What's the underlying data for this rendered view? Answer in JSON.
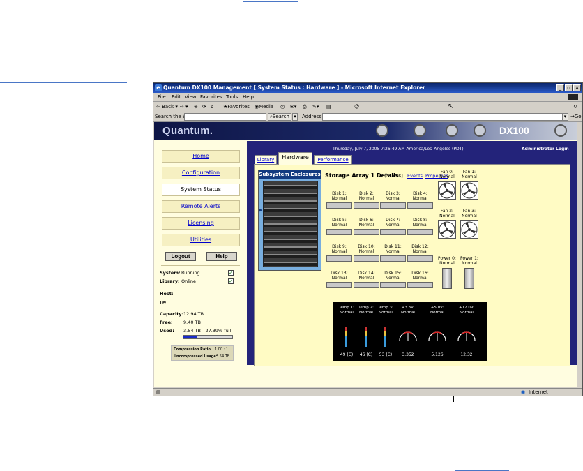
{
  "window": {
    "title": "Quantum DX100 Management [ System Status : Hardware ] - Microsoft Internet Explorer"
  },
  "menu": [
    "File",
    "Edit",
    "View",
    "Favorites",
    "Tools",
    "Help"
  ],
  "toolbar": {
    "back": "Back",
    "favorites": "Favorites",
    "media": "Media"
  },
  "searchbar": {
    "label": "Search the Web",
    "search_btn": "Search",
    "address_label": "Address",
    "go": "Go"
  },
  "banner": {
    "logo": "Quantum.",
    "model": "DX100"
  },
  "header": {
    "datetime": "Thursday, July 7, 2005 7:26:49 AM America/Los_Angeles (PDT)",
    "login": "Administrator Login"
  },
  "nav": [
    "Home",
    "Configuration",
    "System Status",
    "Remote Alerts",
    "Licensing",
    "Utilities"
  ],
  "buttons": {
    "logout": "Logout",
    "help": "Help"
  },
  "status": {
    "system_label": "System:",
    "system_value": "Running",
    "library_label": "Library:",
    "library_value": "Online",
    "host_label": "Host:",
    "ip_label": "IP:",
    "capacity_label": "Capacity:",
    "capacity_value": "12.94 TB",
    "free_label": "Free:",
    "free_value": "9.40 TB",
    "used_label": "Used:",
    "used_value": "3.54 TB - 27.39% full",
    "used_fraction": 0.2739,
    "compression_label": "Compression Ratio",
    "compression_value": "1.00 : 1",
    "uncompressed_label": "Uncompressed Usage:",
    "uncompressed_value": "3.54 TB"
  },
  "tabs": [
    "Library",
    "Hardware",
    "Performance"
  ],
  "subsystem": {
    "title": "Subsystem Enclosures"
  },
  "details": {
    "title": "Storage Array 1 Details:",
    "status": "[Status]",
    "events": "Events",
    "properties": "Properties"
  },
  "disks": [
    {
      "name": "Disk 1:",
      "state": "Normal"
    },
    {
      "name": "Disk 2:",
      "state": "Normal"
    },
    {
      "name": "Disk 3:",
      "state": "Normal"
    },
    {
      "name": "Disk 4:",
      "state": "Normal"
    },
    {
      "name": "Disk 5:",
      "state": "Normal"
    },
    {
      "name": "Disk 6:",
      "state": "Normal"
    },
    {
      "name": "Disk 7:",
      "state": "Normal"
    },
    {
      "name": "Disk 8:",
      "state": "Normal"
    },
    {
      "name": "Disk 9:",
      "state": "Normal"
    },
    {
      "name": "Disk 10:",
      "state": "Normal"
    },
    {
      "name": "Disk 11:",
      "state": "Normal"
    },
    {
      "name": "Disk 12:",
      "state": "Normal"
    },
    {
      "name": "Disk 13:",
      "state": "Normal"
    },
    {
      "name": "Disk 14:",
      "state": "Normal"
    },
    {
      "name": "Disk 15:",
      "state": "Normal"
    },
    {
      "name": "Disk 16:",
      "state": "Normal"
    }
  ],
  "fans": [
    {
      "name": "Fan 0:",
      "state": "Normal"
    },
    {
      "name": "Fan 1:",
      "state": "Normal"
    },
    {
      "name": "Fan 2:",
      "state": "Normal"
    },
    {
      "name": "Fan 3:",
      "state": "Normal"
    }
  ],
  "power": [
    {
      "name": "Power 0:",
      "state": "Normal"
    },
    {
      "name": "Power 1:",
      "state": "Normal"
    }
  ],
  "sensors": [
    {
      "name": "Temp 1:",
      "state": "Normal",
      "reading": "49 (C)"
    },
    {
      "name": "Temp 2:",
      "state": "Normal",
      "reading": "46 (C)"
    },
    {
      "name": "Temp 3:",
      "state": "Normal",
      "reading": "53 (C)"
    },
    {
      "name": "+3.3V:",
      "state": "Normal",
      "reading": "3.352"
    },
    {
      "name": "+5.0V:",
      "state": "Normal",
      "reading": "5.126"
    },
    {
      "name": "+12.0V:",
      "state": "Normal",
      "reading": "12.32"
    }
  ],
  "statusbar": {
    "zone": "Internet"
  }
}
